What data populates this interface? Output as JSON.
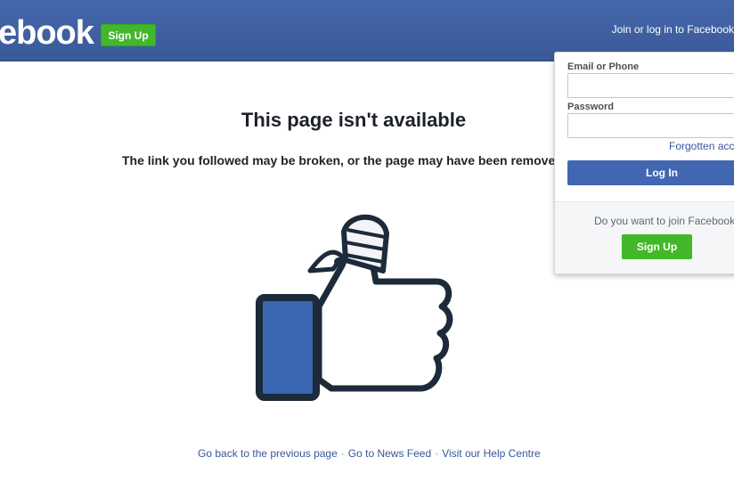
{
  "header": {
    "logo_text": "ebook",
    "signup_label": "Sign Up",
    "join_text": "Join or log in to Facebook"
  },
  "main": {
    "title": "This page isn't available",
    "subtitle": "The link you followed may be broken, or the page may have been removed.",
    "illustration_icon": "broken-thumbs-up-icon"
  },
  "footer": {
    "links": [
      "Go back to the previous page",
      "Go to News Feed",
      "Visit our Help Centre"
    ],
    "separator": "·"
  },
  "login_panel": {
    "email_label": "Email or Phone",
    "email_value": "",
    "password_label": "Password",
    "password_value": "",
    "forgot_label": "Forgotten account?",
    "login_label": "Log In",
    "join_question": "Do you want to join Facebook?",
    "signup_label": "Sign Up"
  },
  "colors": {
    "brand_blue": "#3b5998",
    "signup_green": "#42b72a",
    "login_blue": "#4267b2",
    "link_color": "#365899"
  }
}
